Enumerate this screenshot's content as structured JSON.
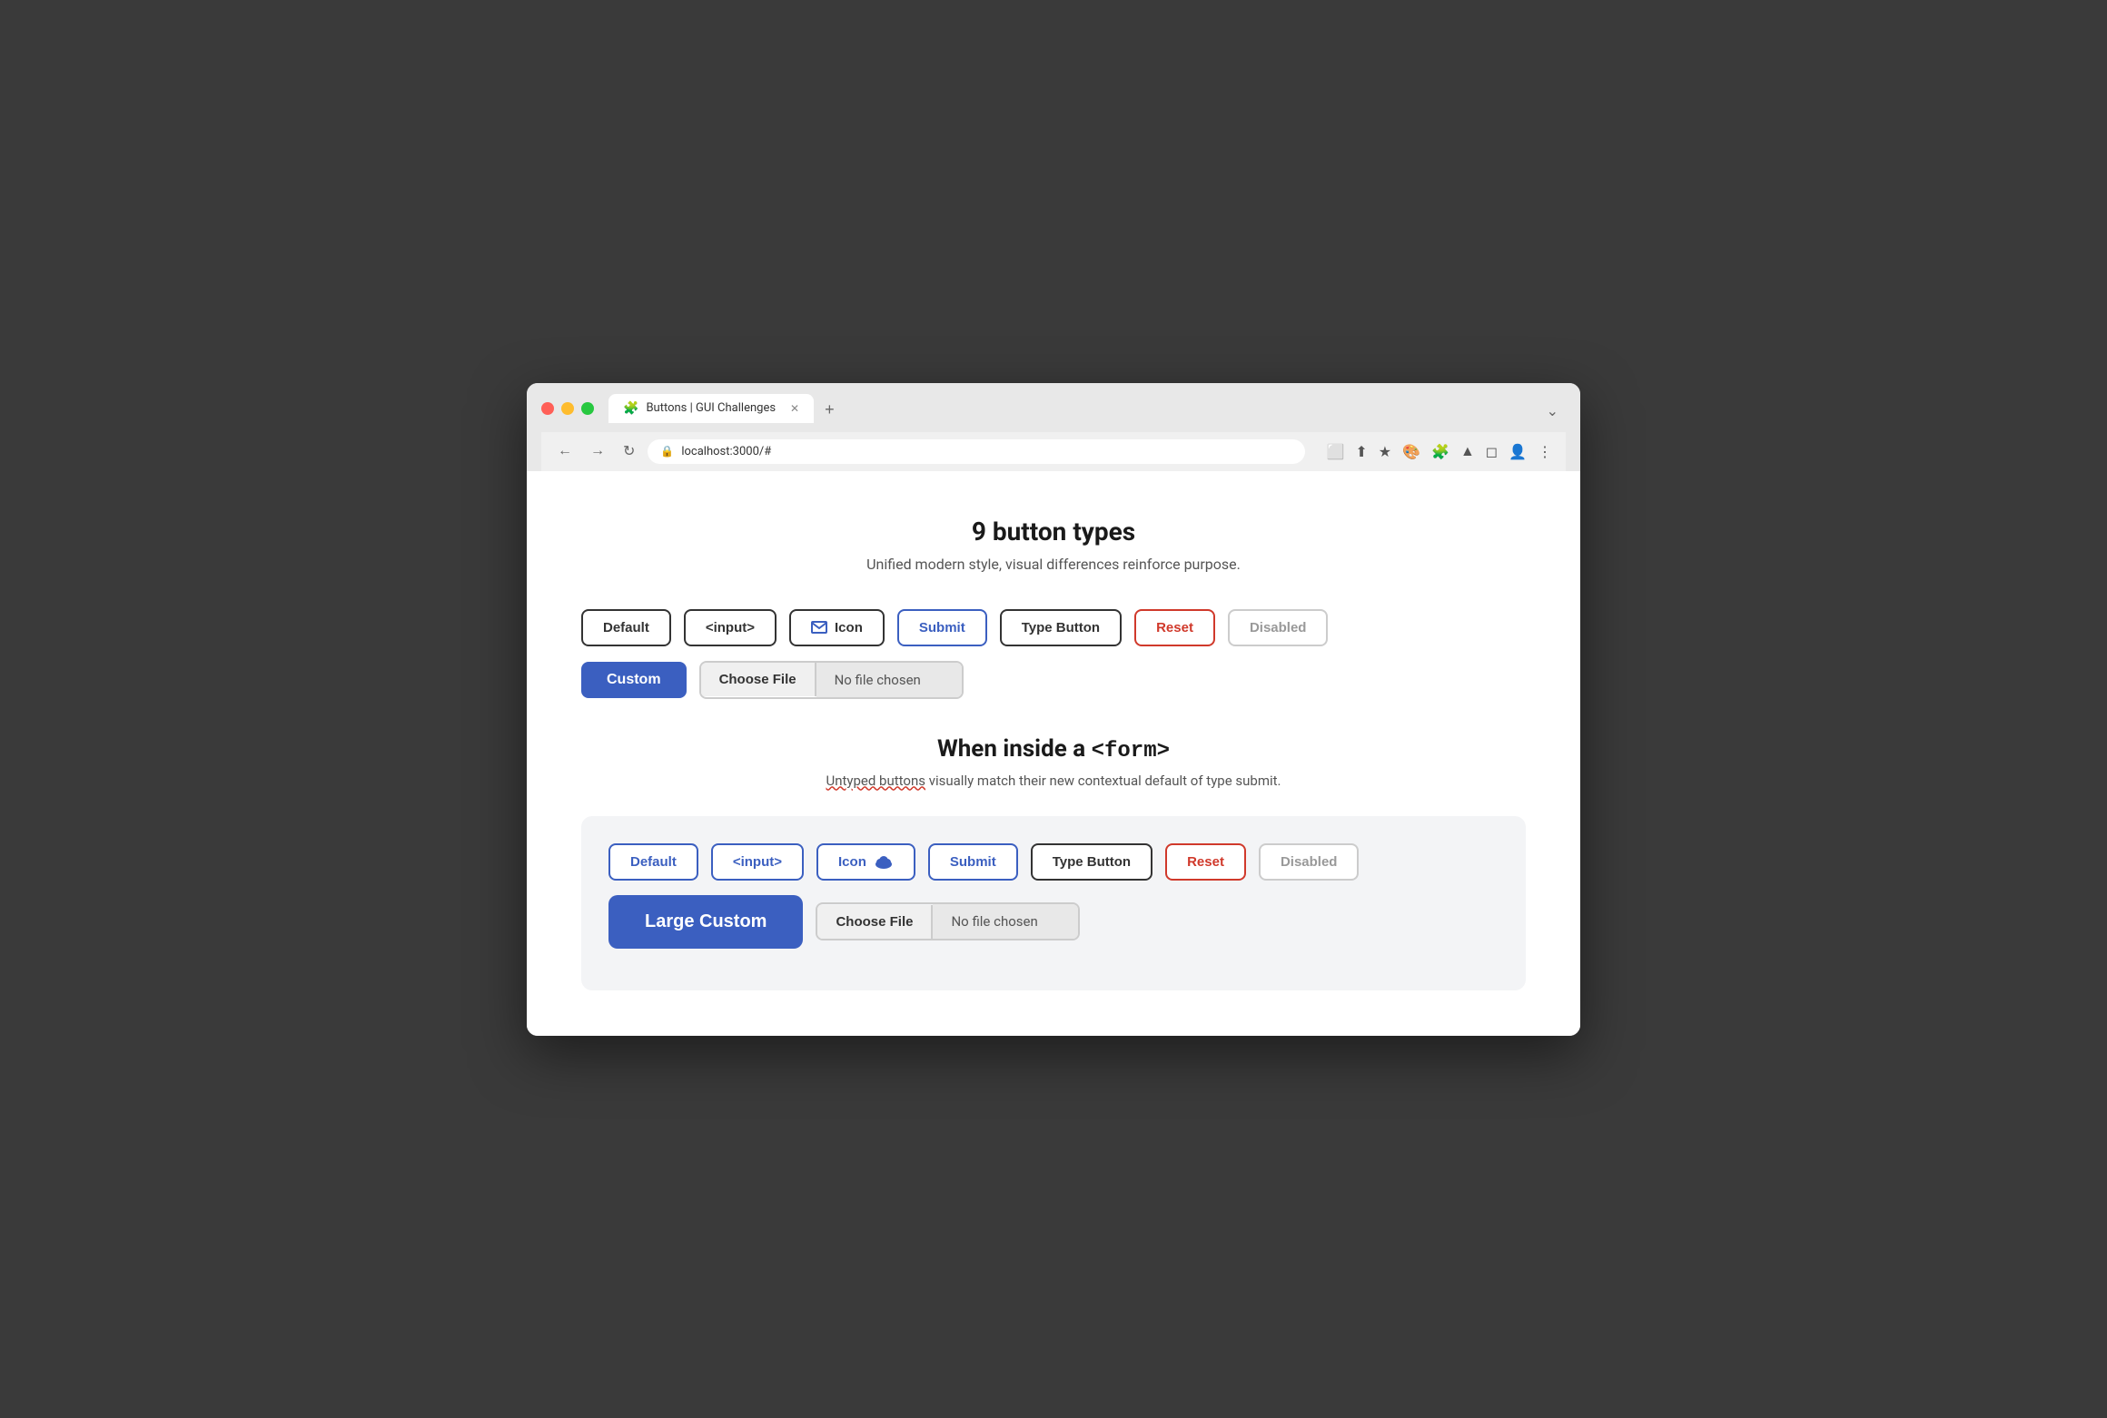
{
  "browser": {
    "traffic_lights": [
      "red",
      "yellow",
      "green"
    ],
    "tab_label": "Buttons | GUI Challenges",
    "tab_icon": "🧩",
    "tab_close": "✕",
    "new_tab_icon": "+",
    "tab_end_icon": "⌄",
    "nav_back": "←",
    "nav_forward": "→",
    "nav_reload": "↻",
    "url": "localhost:3000/#",
    "toolbar_icons": [
      "⬜",
      "⬆",
      "★",
      "🎨",
      "🧩",
      "▲",
      "◻",
      "👤",
      "⋮"
    ]
  },
  "main_section": {
    "title": "9 button types",
    "subtitle": "Unified modern style, visual differences reinforce purpose.",
    "buttons": [
      {
        "label": "Default",
        "type": "default"
      },
      {
        "label": "<input>",
        "type": "input"
      },
      {
        "label": "Icon",
        "type": "icon",
        "icon": "envelope"
      },
      {
        "label": "Submit",
        "type": "submit"
      },
      {
        "label": "Type Button",
        "type": "type-button"
      },
      {
        "label": "Reset",
        "type": "reset"
      },
      {
        "label": "Disabled",
        "type": "disabled"
      }
    ],
    "custom_button_label": "Custom",
    "file_choose_label": "Choose File",
    "file_no_chosen_label": "No file chosen"
  },
  "form_section": {
    "title_prefix": "When inside a ",
    "title_code": "<form>",
    "subtitle_normal": " visually match their new contextual default of type submit.",
    "subtitle_underline": "Untyped buttons",
    "buttons": [
      {
        "label": "Default",
        "type": "default-form"
      },
      {
        "label": "<input>",
        "type": "input-form"
      },
      {
        "label": "Icon",
        "type": "icon-form",
        "icon": "cloud"
      },
      {
        "label": "Submit",
        "type": "submit-form"
      },
      {
        "label": "Type Button",
        "type": "type-button-form"
      },
      {
        "label": "Reset",
        "type": "reset-form"
      },
      {
        "label": "Disabled",
        "type": "disabled-form"
      }
    ],
    "large_custom_label": "Large Custom",
    "file_choose_label": "Choose File",
    "file_no_chosen_label": "No file chosen"
  }
}
